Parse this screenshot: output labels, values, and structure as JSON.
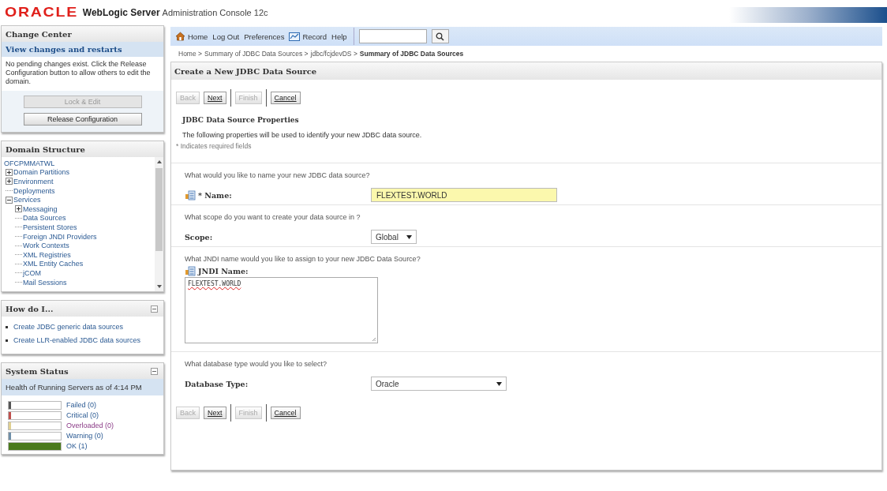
{
  "header": {
    "brand": "ORACLE",
    "product": "WebLogic Server",
    "subtitle": "Administration Console 12c"
  },
  "change_center": {
    "title": "Change Center",
    "link": "View changes and restarts",
    "message": "No pending changes exist. Click the Release Configuration button to allow others to edit the domain.",
    "buttons": [
      {
        "label": "Lock & Edit",
        "disabled": true
      },
      {
        "label": "Release Configuration",
        "disabled": false
      }
    ]
  },
  "domain_structure": {
    "title": "Domain Structure",
    "tree": [
      {
        "label": "OFCPMMATWL",
        "children": [
          {
            "label": "Domain Partitions",
            "expanded": false
          },
          {
            "label": "Environment",
            "expanded": false
          },
          {
            "label": "Deployments"
          },
          {
            "label": "Services",
            "expanded": true,
            "children": [
              {
                "label": "Messaging",
                "expanded": false
              },
              {
                "label": "Data Sources"
              },
              {
                "label": "Persistent Stores"
              },
              {
                "label": "Foreign JNDI Providers"
              },
              {
                "label": "Work Contexts"
              },
              {
                "label": "XML Registries"
              },
              {
                "label": "XML Entity Caches"
              },
              {
                "label": "jCOM"
              },
              {
                "label": "Mail Sessions"
              }
            ]
          }
        ]
      }
    ]
  },
  "how_do_i": {
    "title": "How do I...",
    "links": [
      "Create JDBC generic data sources",
      "Create LLR-enabled JDBC data sources"
    ]
  },
  "system_status": {
    "title": "System Status",
    "subtitle": "Health of Running Servers as of  4:14 PM",
    "items": [
      {
        "label": "Failed (0)",
        "color": "#555555",
        "level": 0
      },
      {
        "label": "Critical (0)",
        "color": "#c0504d",
        "level": 0
      },
      {
        "label": "Overloaded (0)",
        "color": "#e0d090",
        "level": 0
      },
      {
        "label": "Warning (0)",
        "color": "#6f8fa8",
        "level": 0
      },
      {
        "label": "OK (1)",
        "color": "#4a7a1c",
        "level": 1
      }
    ]
  },
  "toolbar": {
    "links": [
      {
        "label": "Home",
        "kind": "home"
      },
      {
        "label": "Log Out",
        "kind": "plain"
      },
      {
        "label": "Preferences",
        "kind": "plain"
      },
      {
        "label": "Record",
        "kind": "record"
      },
      {
        "label": "Help",
        "kind": "plain"
      }
    ]
  },
  "breadcrumbs": [
    {
      "text": "Home >",
      "current": false
    },
    {
      "text": "Summary of JDBC Data Sources >",
      "current": false
    },
    {
      "text": "jdbc/fcjdevDS >",
      "current": false
    },
    {
      "text": "Summary of JDBC Data Sources",
      "current": true
    }
  ],
  "panel": {
    "title": "Create a New JDBC Data Source",
    "section_title": "JDBC Data Source Properties",
    "description": "The following properties will be used to identify your new JDBC data source.",
    "required_note": "* Indicates required fields",
    "top_buttons": [
      {
        "label": "Back",
        "disabled": true
      },
      {
        "label": "Next",
        "disabled": false
      },
      {
        "label": "Finish",
        "disabled": true
      },
      {
        "label": "Cancel",
        "disabled": false
      }
    ],
    "bottom_buttons": [
      {
        "label": "Back",
        "disabled": true
      },
      {
        "label": "Next",
        "disabled": false
      },
      {
        "label": "Finish",
        "disabled": true
      },
      {
        "label": "Cancel",
        "disabled": false
      }
    ],
    "fields": [
      {
        "question": "What would you like to name your new JDBC data source?",
        "label": "* Name:",
        "icon": true,
        "kind": "text",
        "value": "FLEXTEST.WORLD"
      },
      {
        "question": "What scope do you want to create your data source in ?",
        "label": "Scope:",
        "icon": false,
        "kind": "select",
        "value": "Global"
      },
      {
        "question": "What JNDI name would you like to assign to your new JDBC Data Source?",
        "label": "JNDI Name:",
        "icon": true,
        "kind": "textarea",
        "value": "FLEXTEST.WORLD"
      },
      {
        "question": "What database type would you like to select?",
        "label": "Database Type:",
        "icon": false,
        "kind": "wide-select",
        "value": "Oracle"
      }
    ]
  }
}
